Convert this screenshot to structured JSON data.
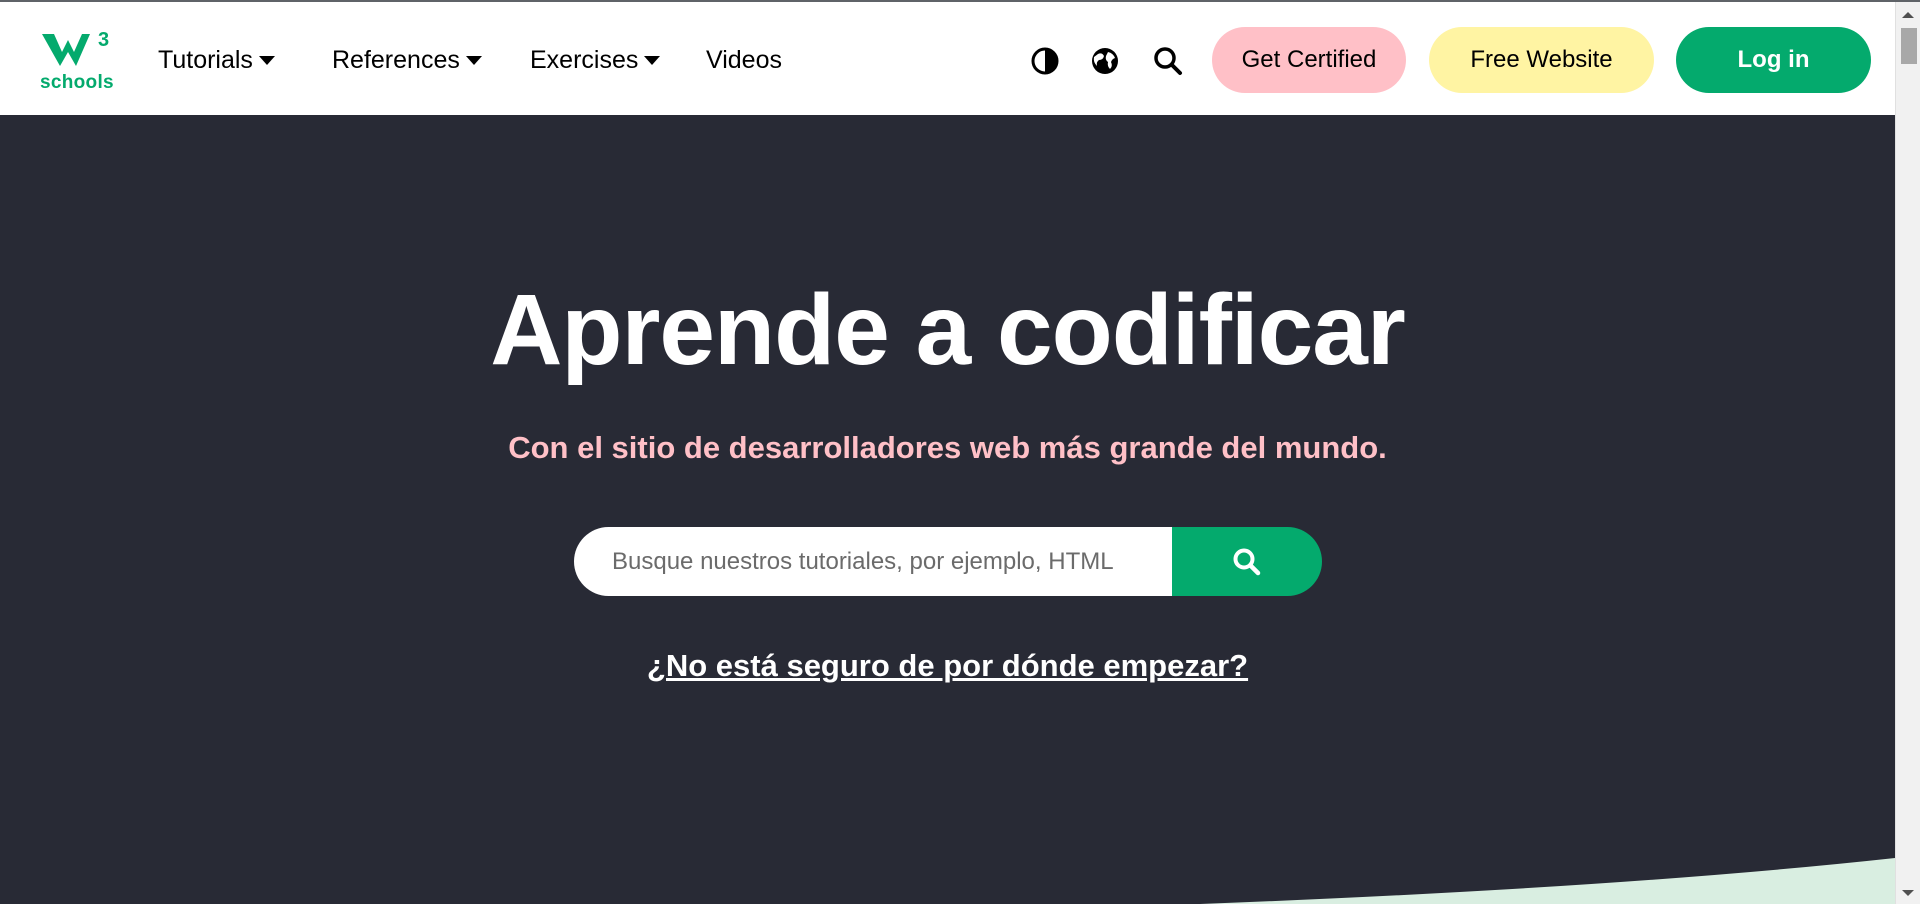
{
  "brand": {
    "logo_mark": "w3",
    "logo_text": "schools",
    "accent_color": "#04AA6D"
  },
  "nav": {
    "items": [
      {
        "label": "Tutorials",
        "has_dropdown": true
      },
      {
        "label": "References",
        "has_dropdown": true
      },
      {
        "label": "Exercises",
        "has_dropdown": true
      },
      {
        "label": "Videos",
        "has_dropdown": false
      }
    ],
    "icons": [
      "contrast-icon",
      "globe-icon",
      "search-icon"
    ],
    "buttons": {
      "certified": "Get Certified",
      "free_website": "Free Website",
      "login": "Log in"
    }
  },
  "hero": {
    "title": "Aprende a codificar",
    "subtitle": "Con el sitio de desarrolladores web más grande del mundo.",
    "search_placeholder": "Busque nuestros tutoriales, por ejemplo, HTML",
    "start_link": "¿No está seguro de por dónde empezar?"
  },
  "colors": {
    "hero_bg": "#282A35",
    "pink": "#FFC0C7",
    "yellow": "#FFF4A3",
    "green": "#04AA6D"
  }
}
